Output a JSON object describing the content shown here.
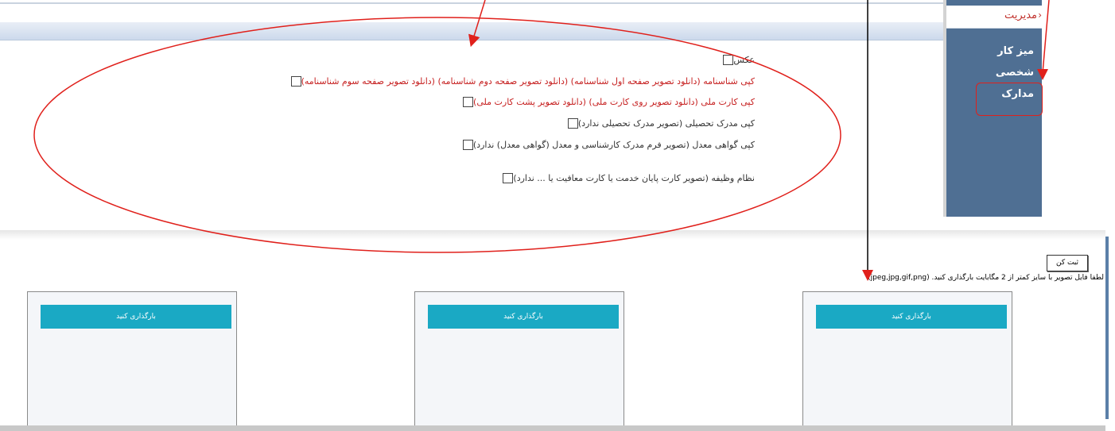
{
  "sidebar": {
    "header": "مدیریت",
    "items": [
      {
        "label": "میز کار"
      },
      {
        "label": "شخصی"
      },
      {
        "label": "مدارک"
      }
    ]
  },
  "documents": [
    {
      "label": "عکس"
    },
    {
      "label": "کپی شناسنامه (دانلود تصویر صفحه اول شناسنامه) (دانلود تصویر صفحه دوم شناسنامه) (دانلود تصویر صفحه سوم شناسنامه)"
    },
    {
      "label": "کپی کارت ملی (دانلود تصویر روی کارت ملی) (دانلود تصویر پشت کارت ملی)"
    },
    {
      "label": "کپی مدرک تحصیلی (تصویر مدرک تحصیلی ندارد)"
    },
    {
      "label": "کپی گواهی معدل (تصویر فرم مدرک کارشناسی و معدل (گواهی معدل) ندارد)"
    },
    {
      "label": "نظام وظیفه (تصویر کارت پایان خدمت یا کارت معافیت یا ... ندارد)"
    }
  ],
  "upload_panel": {
    "submit_label": "ثبت کن",
    "hint": "لطفا فایل تصویر با سایز کمتر از 2 مگابایت بارگذاری کنید. (jpeg,jpg,gif,png)",
    "cards": [
      {
        "button": "بارگذاری کنید"
      },
      {
        "button": "بارگذاری کنید"
      },
      {
        "button": "بارگذاری کنید"
      }
    ]
  },
  "colors": {
    "annotation": "#e0201b",
    "sidebar_bg": "#4f6f93",
    "upload_button": "#1aa9c4"
  }
}
